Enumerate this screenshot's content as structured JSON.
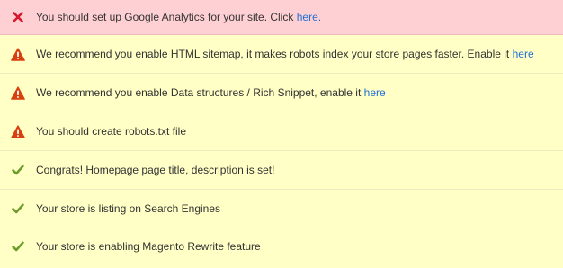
{
  "colors": {
    "error_bg": "#ffd0d3",
    "notice_bg": "#ffffc6",
    "error_icon": "#d6192c",
    "warning_icon": "#d8400e",
    "success_icon": "#6a9c2a",
    "link": "#1f6fd6"
  },
  "items": [
    {
      "status": "error",
      "icon": "x-mark-icon",
      "text": "You should set up Google Analytics for your site. Click ",
      "link": "here."
    },
    {
      "status": "warning",
      "icon": "warning-triangle-icon",
      "text": "We recommend you enable HTML sitemap, it makes robots index your store pages faster. Enable it ",
      "link": "here"
    },
    {
      "status": "warning",
      "icon": "warning-triangle-icon",
      "text": "We recommend you enable Data structures / Rich Snippet, enable it ",
      "link": "here"
    },
    {
      "status": "warning",
      "icon": "warning-triangle-icon",
      "text": "You should create robots.txt file",
      "link": ""
    },
    {
      "status": "success",
      "icon": "checkmark-icon",
      "text": "Congrats! Homepage page title, description is set!",
      "link": ""
    },
    {
      "status": "success",
      "icon": "checkmark-icon",
      "text": "Your store is listing on Search Engines",
      "link": ""
    },
    {
      "status": "success",
      "icon": "checkmark-icon",
      "text": "Your store is enabling Magento Rewrite feature",
      "link": ""
    }
  ]
}
